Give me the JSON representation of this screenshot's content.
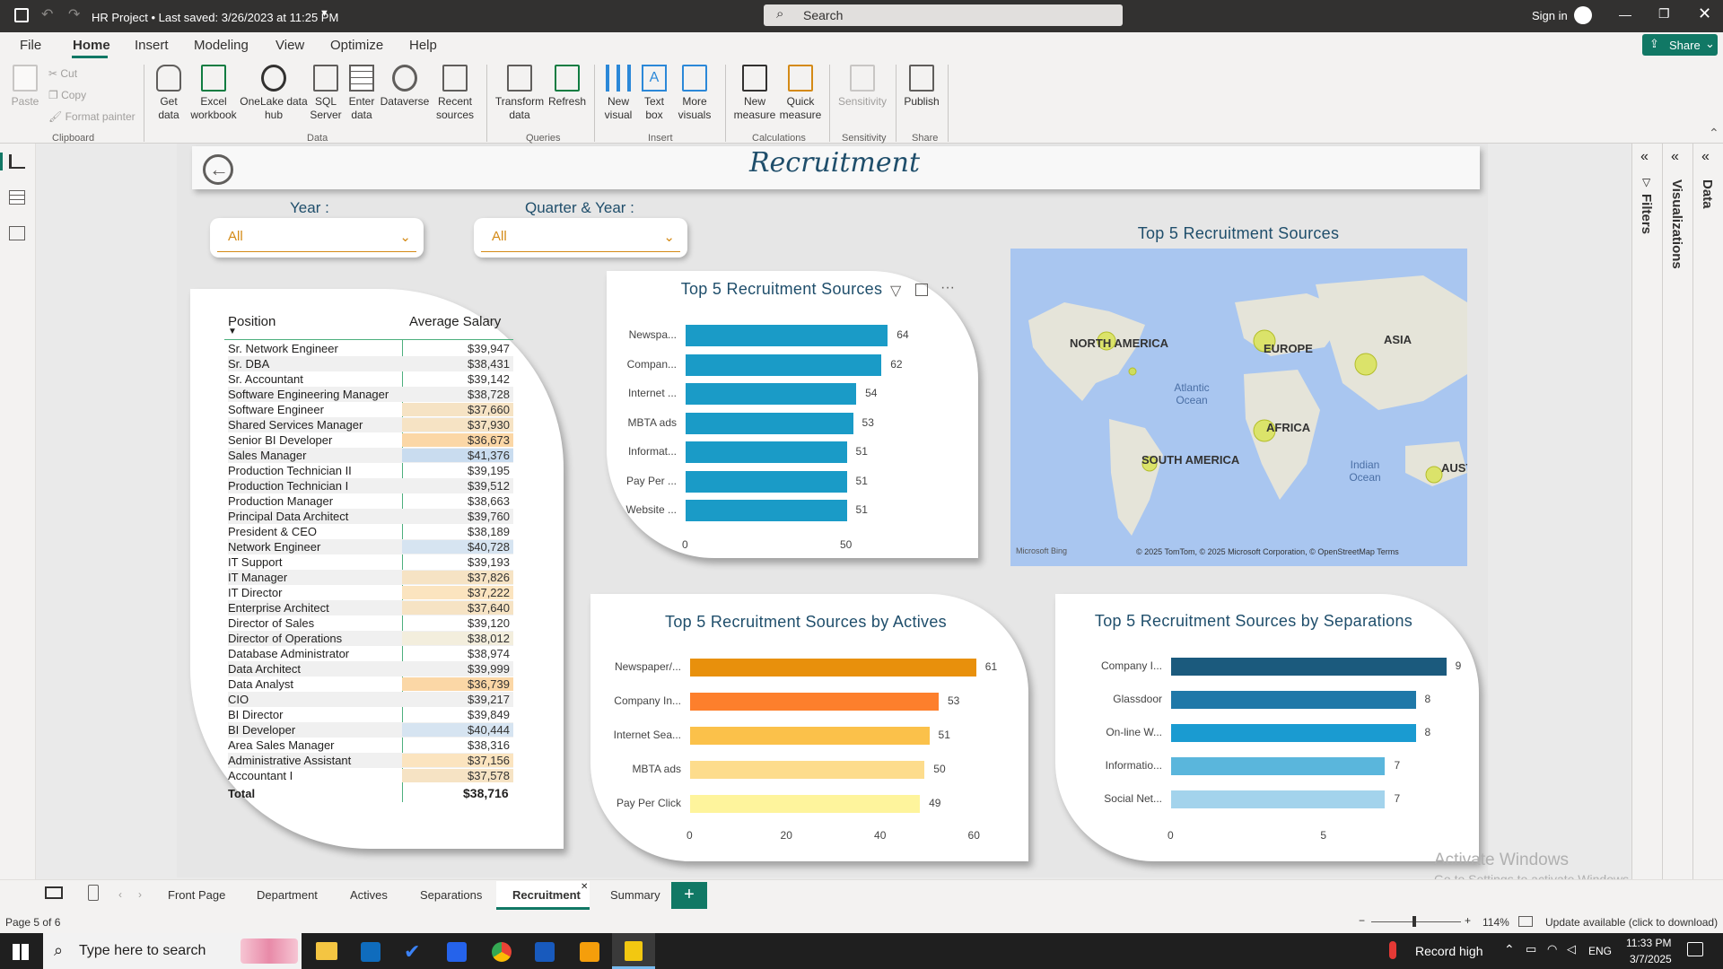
{
  "titlebar": {
    "title": "HR Project • Last saved: 3/26/2023 at 11:25 PM",
    "search": "Search",
    "signin": "Sign in"
  },
  "menu": [
    "File",
    "Home",
    "Insert",
    "Modeling",
    "View",
    "Optimize",
    "Help"
  ],
  "share": "Share",
  "ribbon": {
    "clipboard": {
      "paste": "Paste",
      "cut": "Cut",
      "copy": "Copy",
      "format_painter": "Format painter",
      "group": "Clipboard"
    },
    "data": {
      "get_data": "Get data",
      "excel": "Excel workbook",
      "onelake": "OneLake data hub",
      "sql": "SQL Server",
      "enter": "Enter data",
      "dataverse": "Dataverse",
      "recent": "Recent sources",
      "group": "Data"
    },
    "queries": {
      "transform": "Transform data",
      "refresh": "Refresh",
      "group": "Queries"
    },
    "insert": {
      "new_visual": "New visual",
      "text_box": "Text box",
      "more_visuals": "More visuals",
      "group": "Insert"
    },
    "calc": {
      "new_measure": "New measure",
      "quick_measure": "Quick measure",
      "group": "Calculations"
    },
    "sens": {
      "sensitivity": "Sensitivity",
      "group": "Sensitivity"
    },
    "share": {
      "publish": "Publish",
      "group": "Share"
    }
  },
  "panes": {
    "filters": "Filters",
    "visualizations": "Visualizations",
    "data": "Data"
  },
  "report": {
    "title": "Recruitment",
    "year_label": "Year :",
    "year_value": "All",
    "quarter_label": "Quarter & Year :",
    "quarter_value": "All"
  },
  "table": {
    "col_position": "Position",
    "col_salary": "Average Salary",
    "rows": [
      {
        "p": "Sr. Network Engineer",
        "s": "$39,947"
      },
      {
        "p": "Sr. DBA",
        "s": "$38,431"
      },
      {
        "p": "Sr. Accountant",
        "s": "$39,142"
      },
      {
        "p": "Software Engineering Manager",
        "s": "$38,728"
      },
      {
        "p": "Software Engineer",
        "s": "$37,660"
      },
      {
        "p": "Shared Services Manager",
        "s": "$37,930"
      },
      {
        "p": "Senior BI Developer",
        "s": "$36,673"
      },
      {
        "p": "Sales Manager",
        "s": "$41,376"
      },
      {
        "p": "Production Technician II",
        "s": "$39,195"
      },
      {
        "p": "Production Technician I",
        "s": "$39,512"
      },
      {
        "p": "Production Manager",
        "s": "$38,663"
      },
      {
        "p": "Principal Data Architect",
        "s": "$39,760"
      },
      {
        "p": "President & CEO",
        "s": "$38,189"
      },
      {
        "p": "Network Engineer",
        "s": "$40,728"
      },
      {
        "p": "IT Support",
        "s": "$39,193"
      },
      {
        "p": "IT Manager",
        "s": "$37,826"
      },
      {
        "p": "IT Director",
        "s": "$37,222"
      },
      {
        "p": "Enterprise Architect",
        "s": "$37,640"
      },
      {
        "p": "Director of Sales",
        "s": "$39,120"
      },
      {
        "p": "Director of Operations",
        "s": "$38,012"
      },
      {
        "p": "Database Administrator",
        "s": "$38,974"
      },
      {
        "p": "Data Architect",
        "s": "$39,999"
      },
      {
        "p": "Data Analyst",
        "s": "$36,739"
      },
      {
        "p": "CIO",
        "s": "$39,217"
      },
      {
        "p": "BI Director",
        "s": "$39,849"
      },
      {
        "p": "BI Developer",
        "s": "$40,444"
      },
      {
        "p": "Area Sales Manager",
        "s": "$38,316"
      },
      {
        "p": "Administrative Assistant",
        "s": "$37,156"
      },
      {
        "p": "Accountant I",
        "s": "$37,578"
      }
    ],
    "total_label": "Total",
    "total_value": "$38,716"
  },
  "map": {
    "title": "Top 5 Recruitment Sources",
    "labels": [
      "NORTH AMERICA",
      "EUROPE",
      "ASIA",
      "AFRICA",
      "SOUTH AMERICA",
      "AUSTRA",
      "Atlantic Ocean",
      "Indian Ocean"
    ],
    "attribution": "© 2025 TomTom, © 2025 Microsoft Corporation, © OpenStreetMap  Terms",
    "bing": "Microsoft Bing"
  },
  "chart_data": [
    {
      "type": "bar",
      "title": "Top 5 Recruitment Sources",
      "categories": [
        "Newspa...",
        "Compan...",
        "Internet ...",
        "MBTA ads",
        "Informat...",
        "Pay Per ...",
        "Website ..."
      ],
      "values": [
        64,
        62,
        54,
        53,
        51,
        51,
        51
      ],
      "xlim": [
        0,
        75
      ],
      "xticks": [
        0,
        50
      ],
      "color": "#1a9bc7"
    },
    {
      "type": "bar",
      "title": "Top 5 Recruitment Sources by Actives",
      "categories": [
        "Newspaper/...",
        "Company In...",
        "Internet Sea...",
        "MBTA ads",
        "Pay Per Click"
      ],
      "values": [
        61,
        53,
        51,
        50,
        49
      ],
      "xlim": [
        0,
        62
      ],
      "xticks": [
        0,
        20,
        40,
        60
      ],
      "colors": [
        "#e8900c",
        "#fd7f2c",
        "#fbc14a",
        "#fddc8c",
        "#fef49c"
      ]
    },
    {
      "type": "bar",
      "title": "Top 5 Recruitment Sources by Separations",
      "categories": [
        "Company I...",
        "Glassdoor",
        "On-line W...",
        "Informatio...",
        "Social Net..."
      ],
      "values": [
        9,
        8,
        8,
        7,
        7
      ],
      "xlim": [
        0,
        9.1
      ],
      "xticks": [
        0,
        5
      ],
      "colors": [
        "#1b5a7d",
        "#1f78a8",
        "#1a9bd1",
        "#5ab6dc",
        "#a3d3ec"
      ]
    }
  ],
  "tabs": [
    "Front Page",
    "Department",
    "Actives",
    "Separations",
    "Recruitment",
    "Summary"
  ],
  "status": {
    "page": "Page 5 of 6",
    "zoom": "114%",
    "update": "Update available (click to download)",
    "watermark1": "Activate Windows",
    "watermark2": "Go to Settings to activate Windows."
  },
  "taskbar": {
    "search": "Type here to search",
    "weather": "Record high",
    "lang": "ENG",
    "time": "11:33 PM",
    "date": "3/7/2025"
  }
}
